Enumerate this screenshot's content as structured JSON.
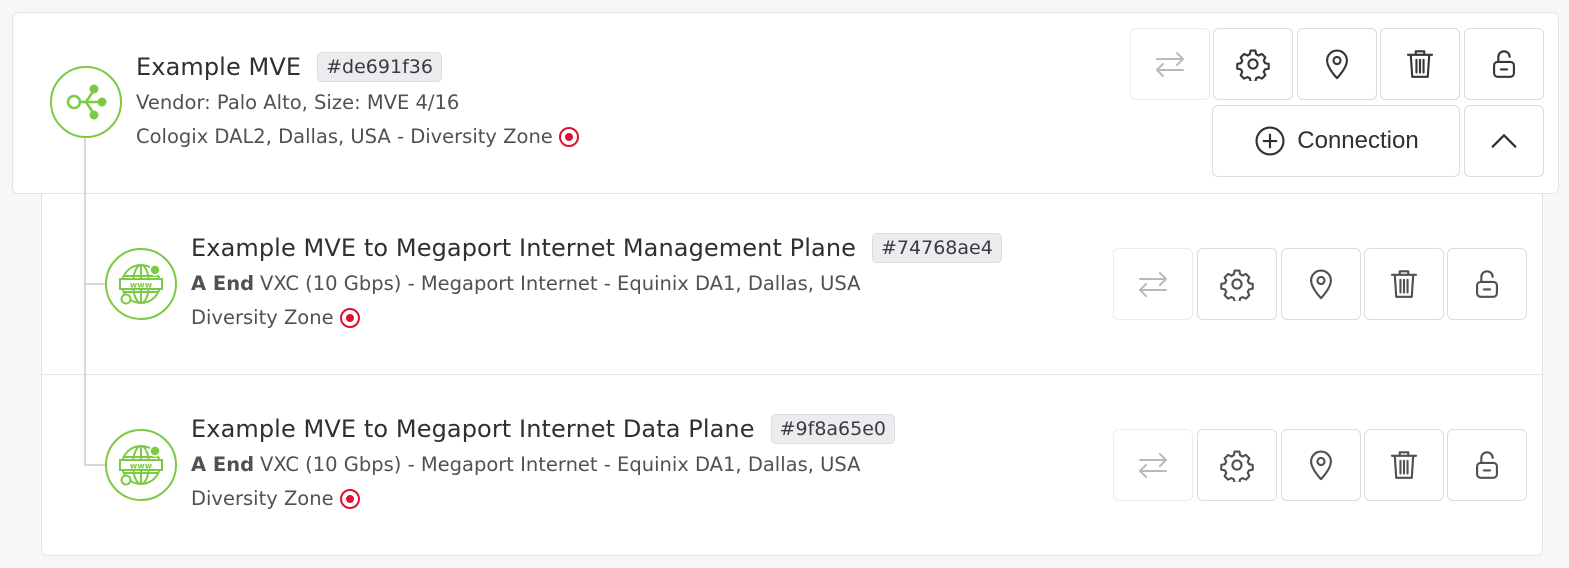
{
  "mve": {
    "title": "Example MVE",
    "uid": "#de691f36",
    "vendor_line": "Vendor: Palo Alto, Size: MVE 4/16",
    "location_line": "Cologix DAL2, Dallas, USA - Diversity Zone",
    "icon": "mve-branch-icon",
    "connection_button_label": "Connection",
    "collapse_icon": "chevron-up-icon"
  },
  "connections": [
    {
      "title": "Example MVE to Megaport Internet Management Plane",
      "uid": "#74768ae4",
      "a_end_label": "A End",
      "details": "VXC (10 Gbps) - Megaport Internet - Equinix DA1, Dallas, USA",
      "diversity_label": "Diversity Zone",
      "icon": "internet-globe-icon"
    },
    {
      "title": "Example MVE to Megaport Internet Data Plane",
      "uid": "#9f8a65e0",
      "a_end_label": "A End",
      "details": "VXC (10 Gbps) - Megaport Internet - Equinix DA1, Dallas, USA",
      "diversity_label": "Diversity Zone",
      "icon": "internet-globe-icon"
    }
  ],
  "action_icons": [
    "swap-arrows-icon",
    "gear-icon",
    "location-pin-icon",
    "trash-icon",
    "unlock-icon"
  ],
  "colors": {
    "accent_green": "#7cc943",
    "diversity_red": "#e0102e",
    "border": "#dcdce0"
  }
}
